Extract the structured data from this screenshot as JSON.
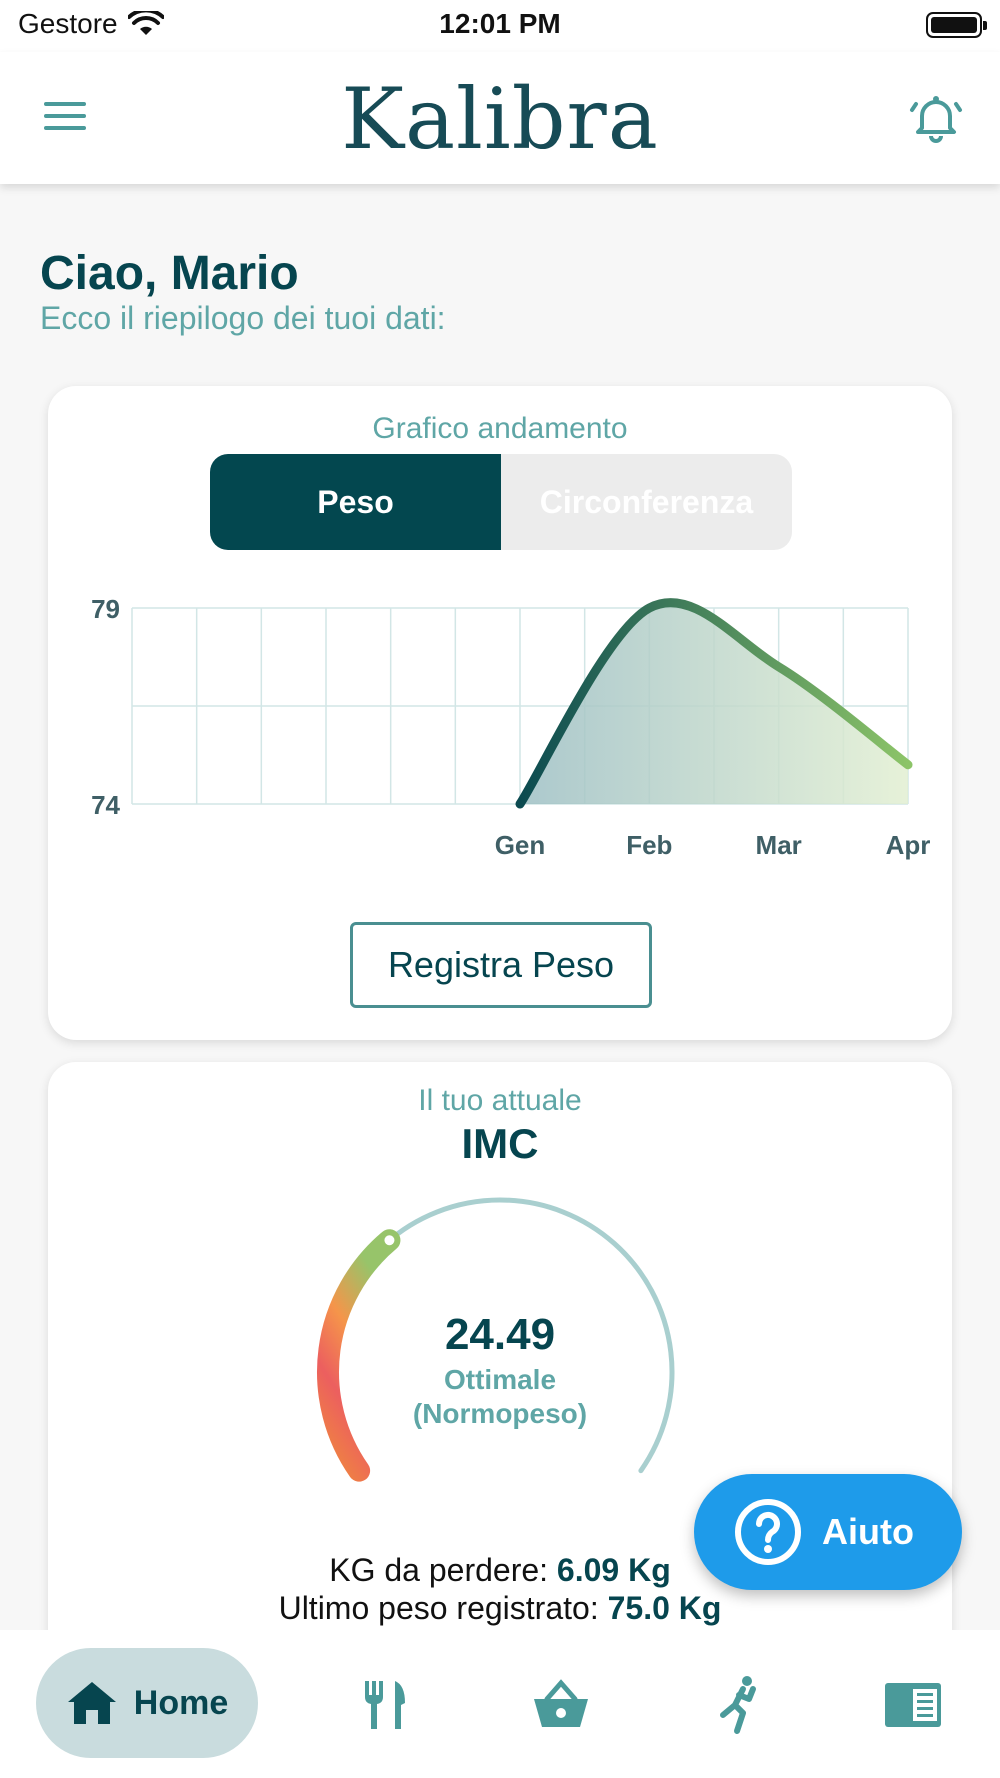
{
  "status_bar": {
    "carrier": "Gestore",
    "time": "12:01 PM"
  },
  "header": {
    "brand": "Kalibra"
  },
  "greeting": {
    "title": "Ciao, Mario",
    "subtitle": "Ecco il riepilogo dei tuoi dati:"
  },
  "chart_card": {
    "label": "Grafico andamento",
    "tabs": [
      {
        "label": "Peso",
        "active": true
      },
      {
        "label": "Circonferenza",
        "active": false
      }
    ],
    "register_button": "Registra Peso"
  },
  "chart_data": {
    "type": "area",
    "categories": [
      "Gen",
      "Feb",
      "Mar",
      "Apr"
    ],
    "series": [
      {
        "values": [
          74,
          79,
          77.5,
          75.0
        ]
      }
    ],
    "y_ticks": [
      74,
      79
    ],
    "ylim": [
      74,
      79
    ],
    "grid": true,
    "colors": {
      "line_start": "#0b4a50",
      "line_end": "#8cc468",
      "fill_start": "#9dbfc4",
      "fill_end": "#e2efd2"
    }
  },
  "imc_card": {
    "label": "Il tuo attuale",
    "title": "IMC",
    "value": "24.49",
    "category_line1": "Ottimale",
    "category_line2": "(Normopeso)",
    "kg_label": "KG da perdere:",
    "kg_value": "6.09 Kg",
    "last_label": "Ultimo peso registrato:",
    "last_value": "75.0 Kg"
  },
  "help": {
    "label": "Aiuto"
  },
  "nav": {
    "home_label": "Home",
    "items": [
      "home-icon",
      "fork-knife-icon",
      "basket-icon",
      "activity-icon",
      "journal-icon"
    ]
  },
  "colors": {
    "primary": "#03474f",
    "accent": "#5fa6a6",
    "help": "#1e9bea"
  }
}
